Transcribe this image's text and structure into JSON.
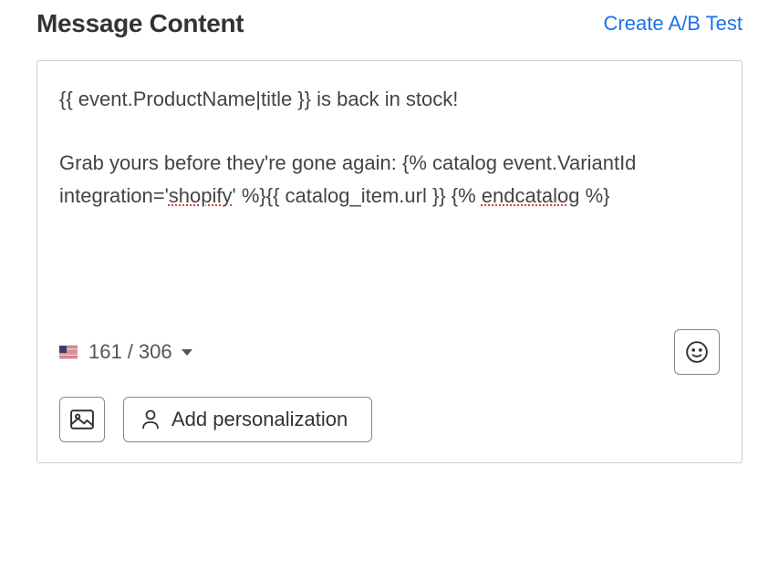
{
  "header": {
    "title": "Message Content",
    "ab_test_link": "Create A/B Test"
  },
  "message": {
    "line1_prefix": "{{ event.ProductName|title }} is back in stock!",
    "line2_prefix": "Grab yours before they're gone again: {% catalog event.VariantId integration='",
    "spellcheck1": "shopify",
    "line2_suffix": "' %}{{ catalog_item.url }} {% ",
    "spellcheck2": "endcatalog",
    "line2_end": " %}"
  },
  "counter": {
    "current": "161",
    "separator": " / ",
    "max": "306"
  },
  "buttons": {
    "add_personalization": "Add personalization"
  },
  "icons": {
    "flag": "us-flag-icon",
    "chevron": "chevron-down-icon",
    "emoji": "emoji-icon",
    "image": "image-icon",
    "person": "person-icon"
  }
}
